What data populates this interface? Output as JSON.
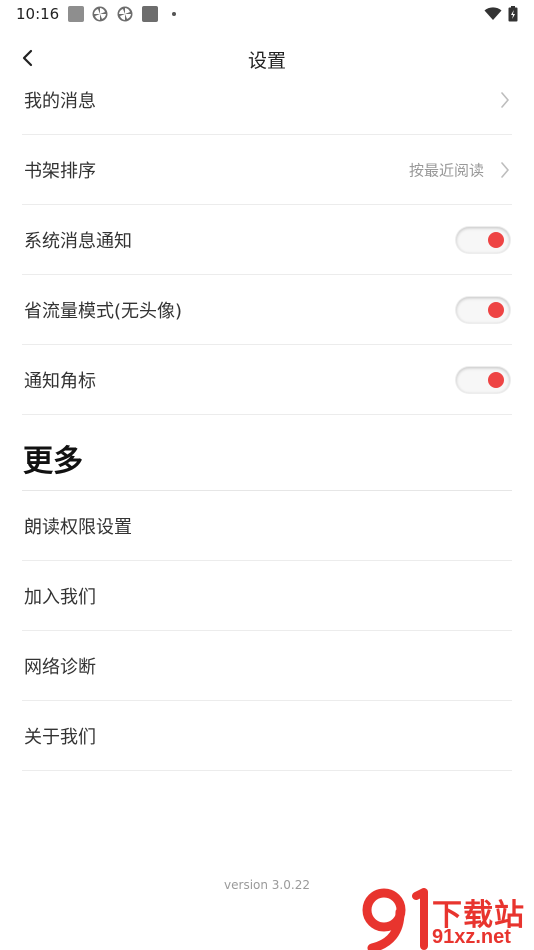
{
  "status_bar": {
    "time": "10:16",
    "icons": [
      "square-icon",
      "pinwheel-icon",
      "pinwheel-icon",
      "square-icon",
      "dot-icon",
      "wifi-icon",
      "battery-icon"
    ]
  },
  "header": {
    "back_icon": "chevron-left-icon",
    "title": "设置"
  },
  "settings": {
    "my_messages": {
      "label": "我的消息",
      "icon": "chevron-right-icon"
    },
    "shelf_sort": {
      "label": "书架排序",
      "value": "按最近阅读",
      "icon": "chevron-right-icon"
    },
    "system_notify": {
      "label": "系统消息通知",
      "on": true
    },
    "data_saver": {
      "label": "省流量模式(无头像)",
      "on": true
    },
    "badge_notify": {
      "label": "通知角标",
      "on": true
    }
  },
  "more": {
    "title": "更多",
    "items": [
      {
        "label": "朗读权限设置"
      },
      {
        "label": "加入我们"
      },
      {
        "label": "网络诊断"
      },
      {
        "label": "关于我们"
      }
    ]
  },
  "footer": {
    "version": "version 3.0.22"
  },
  "watermark": {
    "line1": "下载站",
    "line2": "91xz.net"
  },
  "colors": {
    "accent": "#ee4444",
    "divider": "#ececec",
    "watermark": "#e8342e"
  }
}
